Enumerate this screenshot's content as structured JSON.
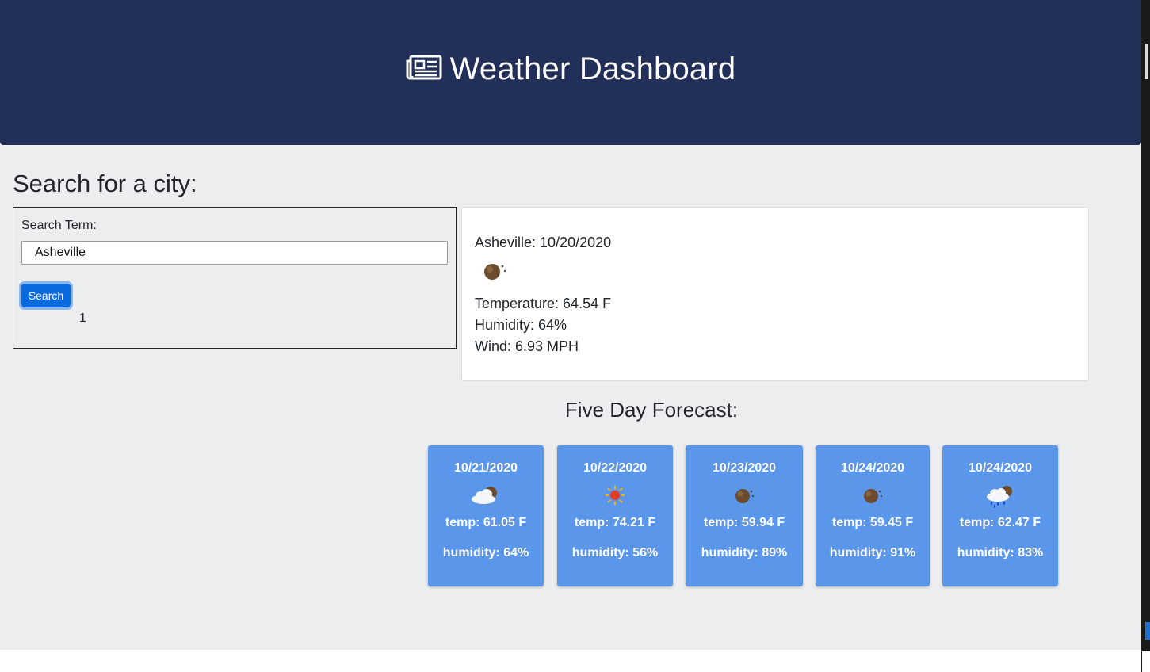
{
  "header": {
    "title": "Weather Dashboard",
    "icon": "newspaper-icon"
  },
  "search": {
    "heading": "Search for a city:",
    "label": "Search Term:",
    "input_value": "Asheville",
    "button_label": "Search",
    "history": [
      "1"
    ]
  },
  "current": {
    "title": "Asheville: 10/20/2020",
    "icon": "clear-night-icon",
    "temperature": "Temperature: 64.54 F",
    "humidity": "Humidity: 64%",
    "wind": "Wind: 6.93 MPH"
  },
  "forecast": {
    "heading": "Five Day Forecast:",
    "days": [
      {
        "date": "10/21/2020",
        "icon": "cloudy-night-icon",
        "temp": "temp: 61.05 F",
        "humidity": "humidity: 64%"
      },
      {
        "date": "10/22/2020",
        "icon": "clear-day-sun-icon",
        "temp": "temp: 74.21 F",
        "humidity": "humidity: 56%"
      },
      {
        "date": "10/23/2020",
        "icon": "clear-night-icon",
        "temp": "temp: 59.94 F",
        "humidity": "humidity: 89%"
      },
      {
        "date": "10/24/2020",
        "icon": "clear-night-icon",
        "temp": "temp: 59.45 F",
        "humidity": "humidity: 91%"
      },
      {
        "date": "10/24/2020",
        "icon": "rain-night-icon",
        "temp": "temp: 62.47 F",
        "humidity": "humidity: 83%"
      }
    ]
  },
  "colors": {
    "header_bg": "#223059",
    "page_bg": "#ecedef",
    "button_bg": "#0a6ae0",
    "forecast_card_bg": "#5a96ea"
  }
}
